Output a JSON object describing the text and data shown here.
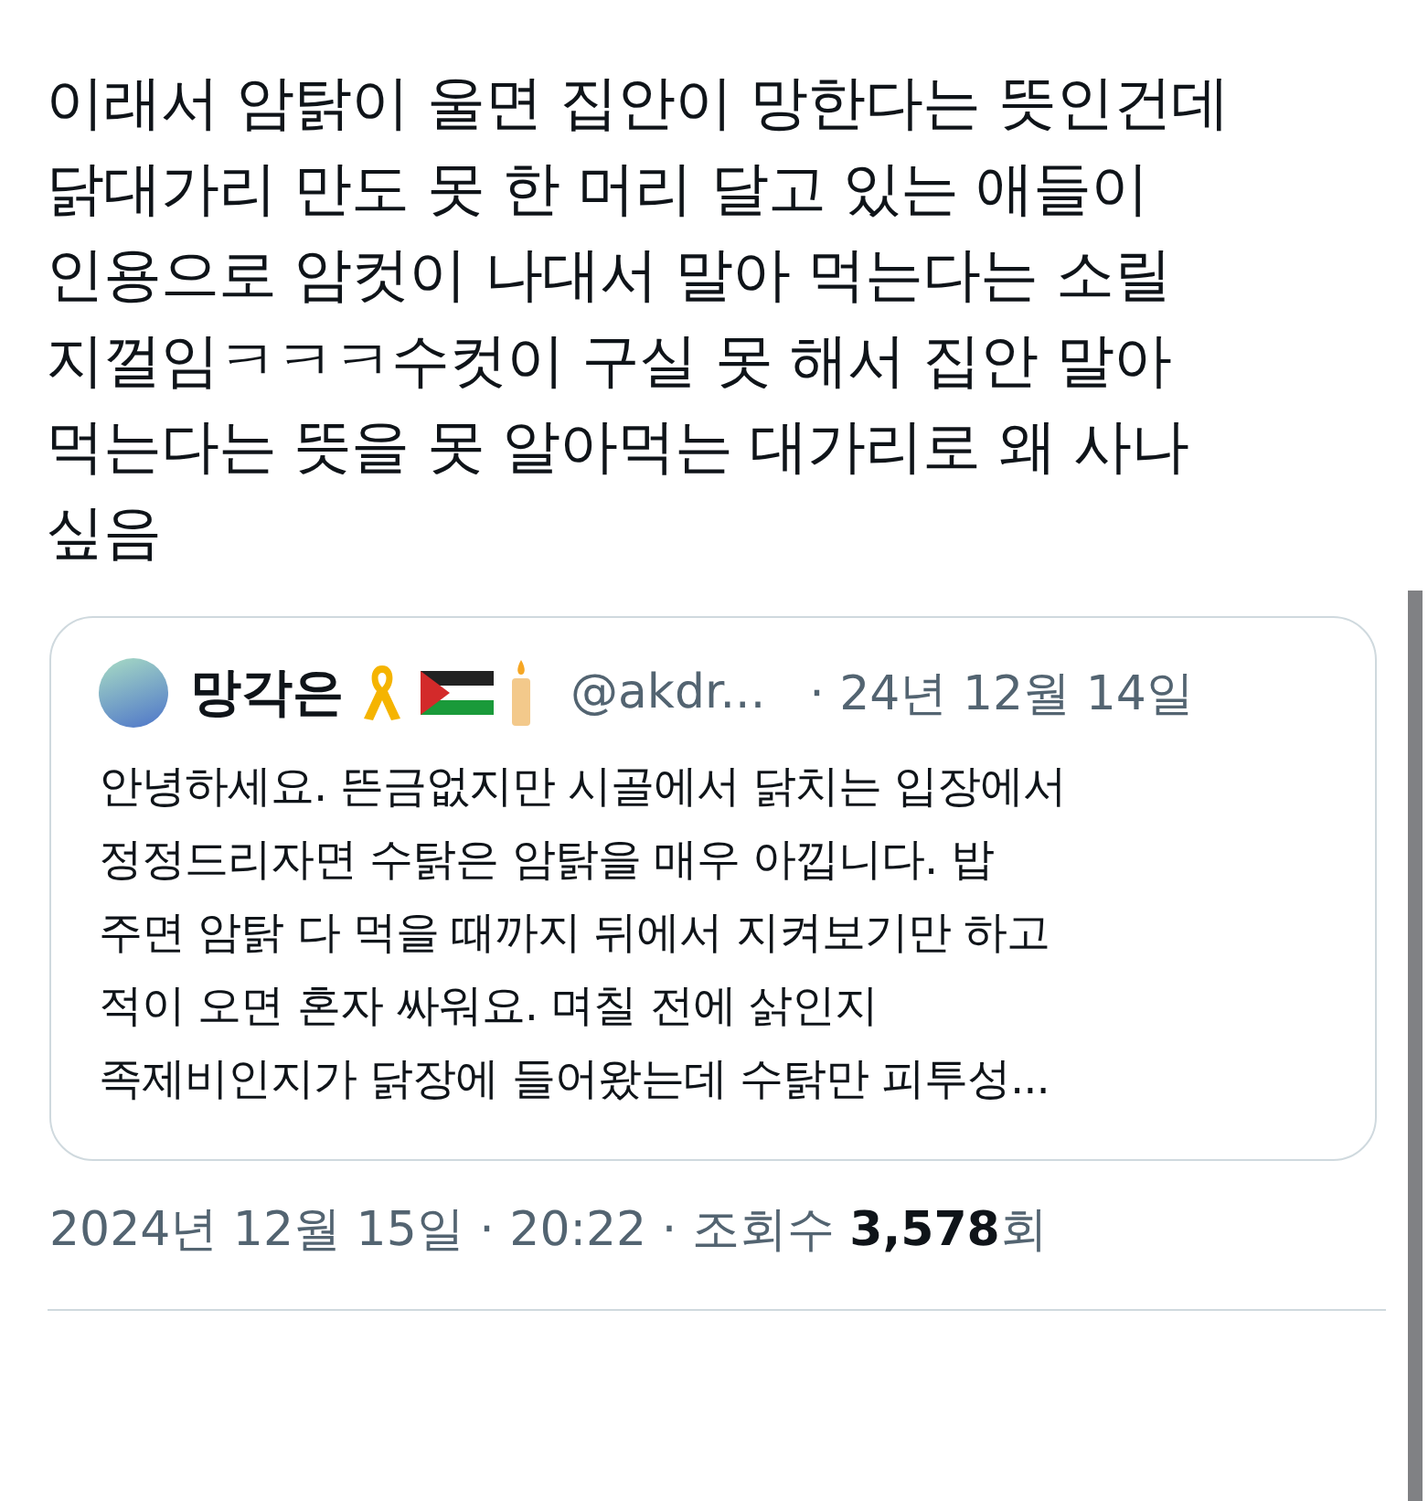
{
  "post": {
    "text": "이래서 암탉이 울면 집안이 망한다는 뜻인건데\n닭대가리 만도 못 한 머리 달고 있는 애들이\n인용으로 암컷이 나대서 말아 먹는다는 소릴\n지껄임ㅋㅋㅋ수컷이 구실 못 해서 집안 말아\n먹는다는 뜻을 못 알아먹는 대가리로 왜 사나\n싶음"
  },
  "quote": {
    "name": "망각은",
    "handle": "@akdr...",
    "date": "· 24년 12월 14일",
    "text": "안녕하세요. 뜬금없지만 시골에서 닭치는 입장에서\n정정드리자면 수탉은 암탉을 매우 아낍니다. 밥\n주면 암탉 다 먹을 때까지 뒤에서 지켜보기만 하고\n적이 오면 혼자 싸워요. 며칠 전에 삵인지\n족제비인지가 닭장에 들어왔는데 수탉만 피투성..."
  },
  "meta": "2024년 12월 15일 · 20:22 · 조회수 **3,578**회"
}
